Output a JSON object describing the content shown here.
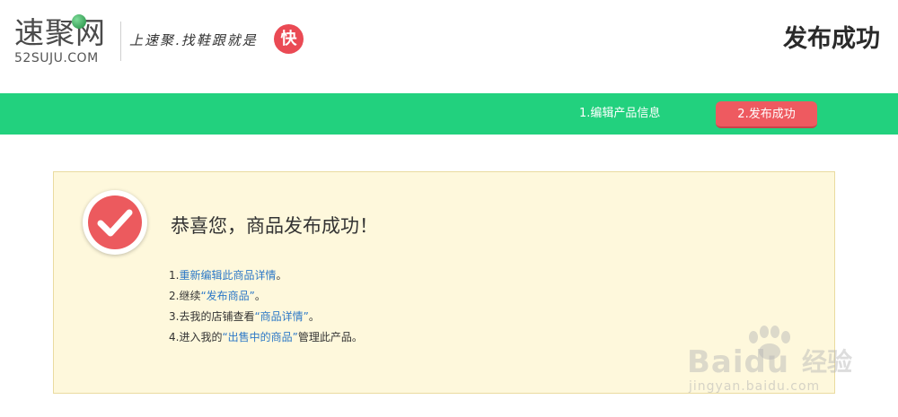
{
  "header": {
    "logo_cn": "速聚网",
    "logo_en": "52SUJU.COM",
    "slogan": "上速聚.找鞋跟就是",
    "slogan_badge": "快",
    "page_title": "发布成功"
  },
  "steps_nav": {
    "step1": "1.编辑产品信息",
    "step2": "2.发布成功",
    "active_step": 2
  },
  "result": {
    "headline": "恭喜您，商品发布成功！",
    "lines": [
      {
        "prefix": "1.",
        "link": "重新编辑此商品详情",
        "suffix": "。"
      },
      {
        "prefix": "2.继续",
        "link": "“发布商品”",
        "suffix": "。"
      },
      {
        "prefix": "3.去我的店铺查看",
        "link": "“商品详情”",
        "suffix": "。"
      },
      {
        "prefix": "4.进入我的",
        "link": "“出售中的商品”",
        "suffix": "管理此产品。"
      }
    ]
  },
  "watermark": {
    "brand": "Baidu",
    "brand_cn": "经验",
    "url": "jingyan.baidu.com"
  },
  "colors": {
    "green_bar": "#22d17e",
    "active_step": "#ee5a60",
    "panel_bg": "#fef8dc",
    "link": "#2d79c7",
    "check": "#ec5a5e"
  },
  "icons": {
    "success": "check-circle-icon",
    "logo_ball": "green-ball-icon",
    "watermark_paw": "paw-icon"
  }
}
